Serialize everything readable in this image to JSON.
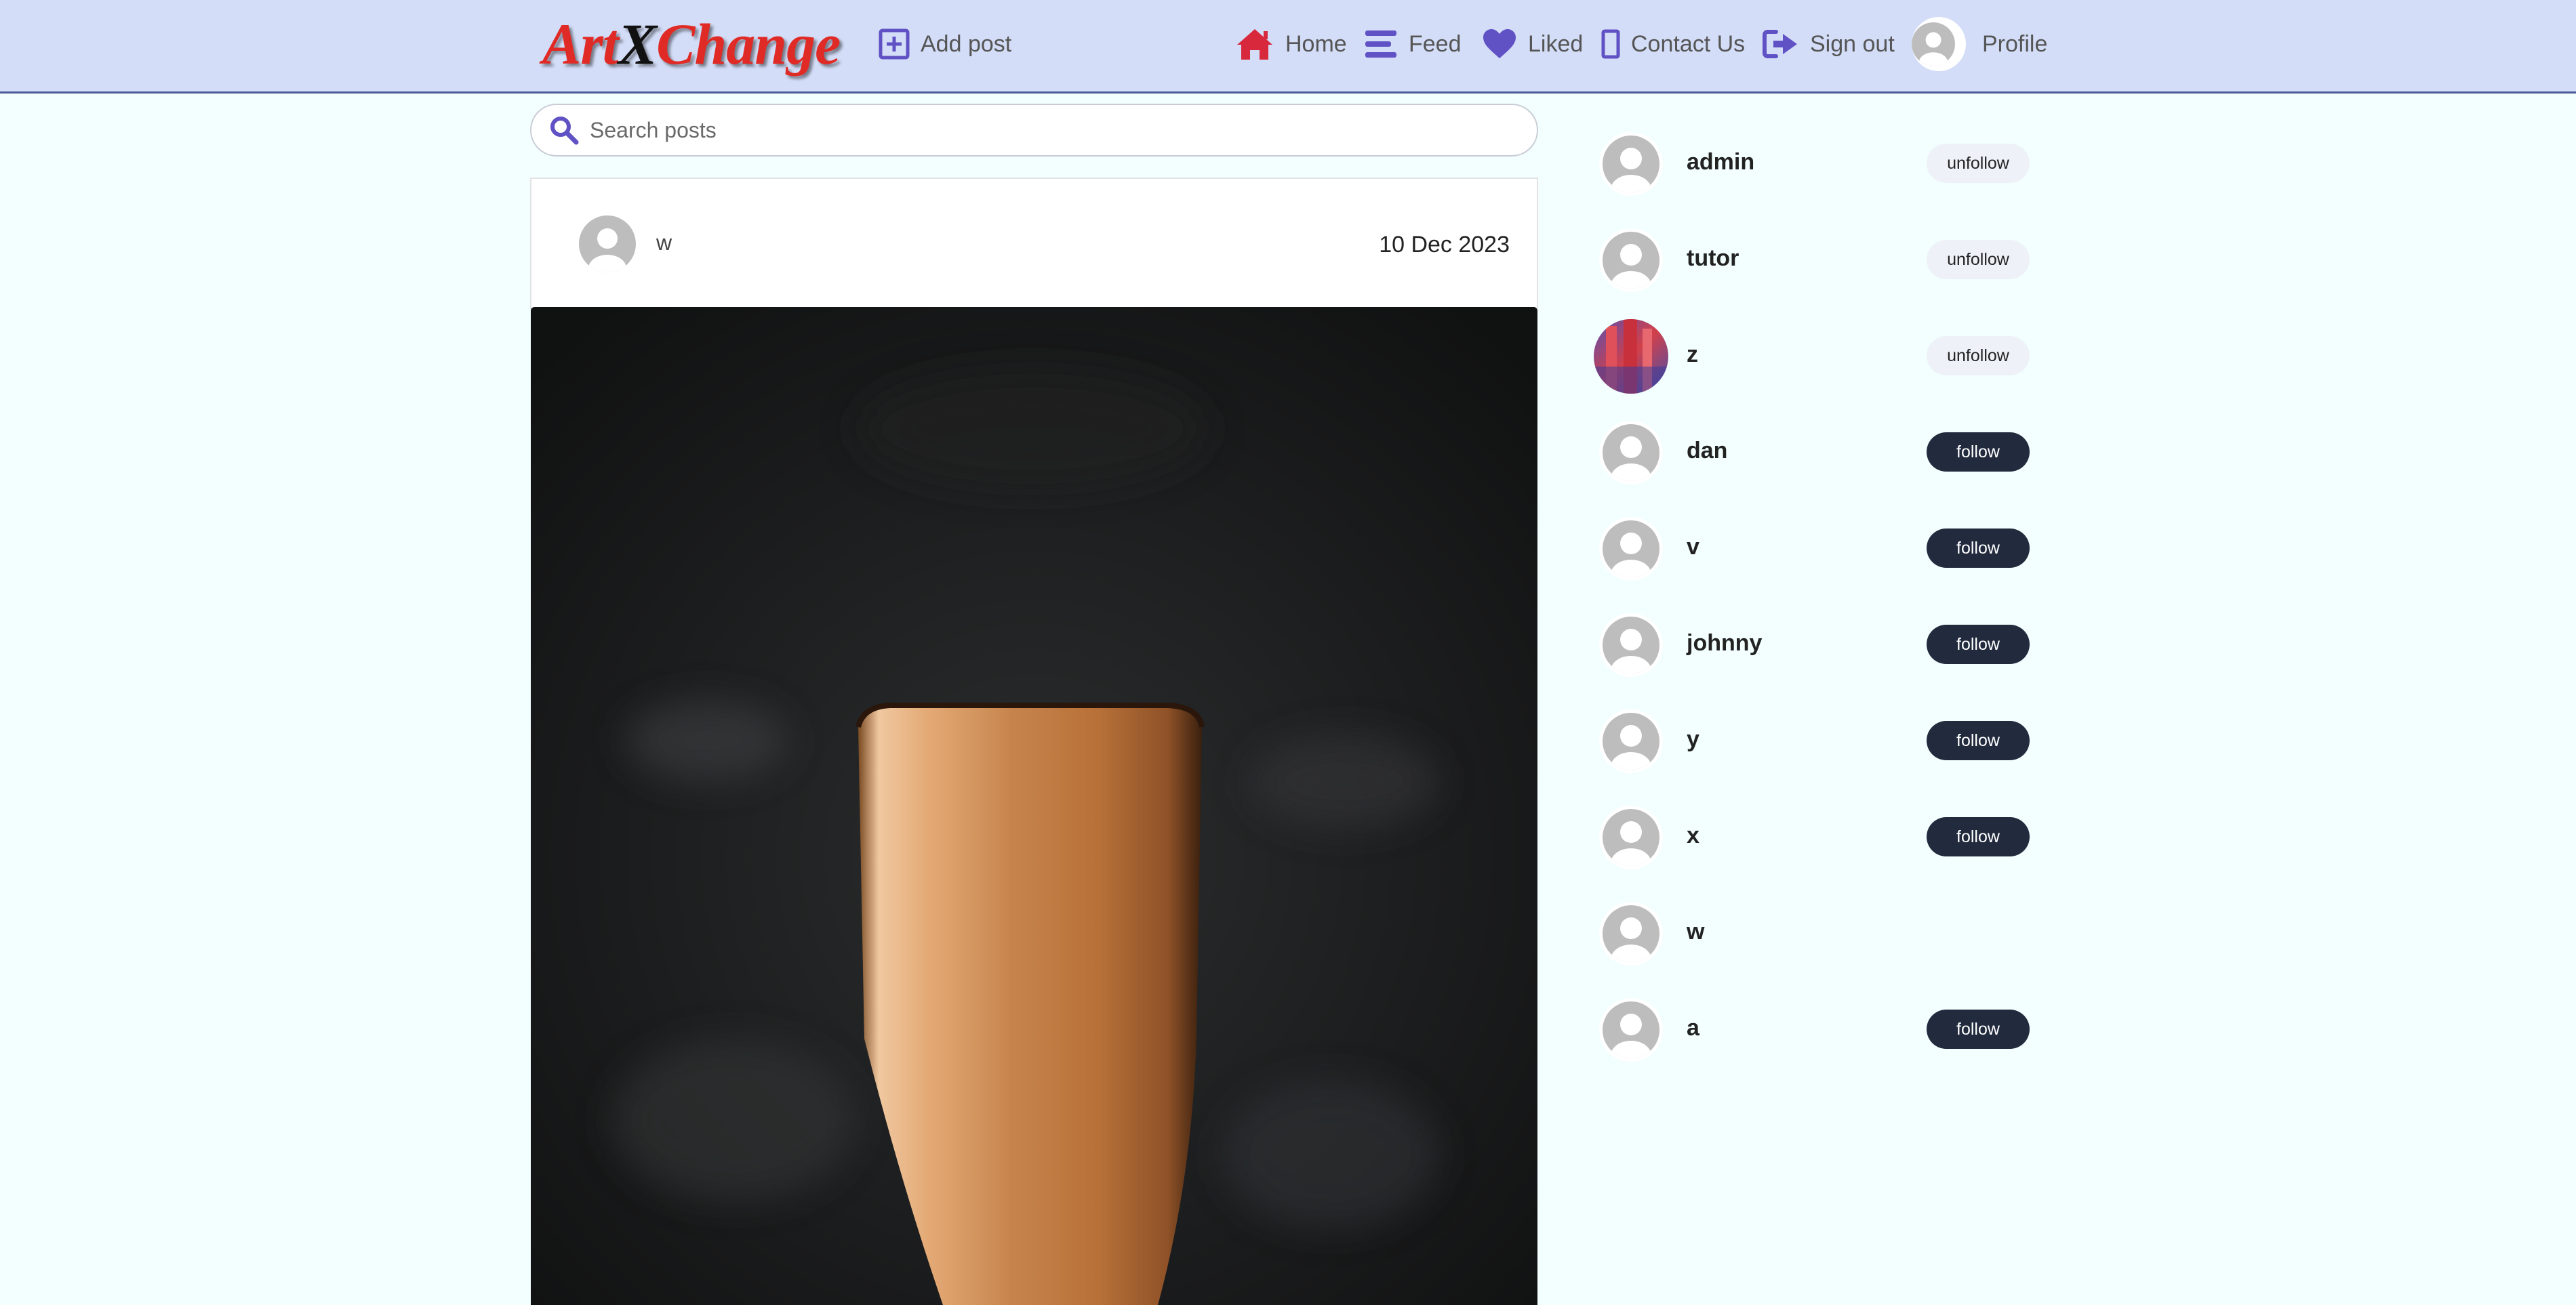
{
  "nav": {
    "logo": {
      "part1": "Art",
      "part2": "X",
      "part3": "Change"
    },
    "add_post": "Add post",
    "home": "Home",
    "feed": "Feed",
    "liked": "Liked",
    "contact": "Contact Us",
    "signout": "Sign out",
    "profile": "Profile"
  },
  "colors": {
    "nav_bg": "#d3ddf7",
    "page_bg": "#f2fffe",
    "accent_purple": "#6052c4",
    "home_red": "#d8283c",
    "follow_btn": "#222a3e",
    "unfollow_btn": "#eef2f8"
  },
  "search": {
    "placeholder": "Search posts",
    "icon": "search-icon"
  },
  "post": {
    "author": "w",
    "date": "10 Dec 2023",
    "image": "photo of a wooden cup on a dark background"
  },
  "users": [
    {
      "name": "admin",
      "action": "unfollow",
      "avatar": "default-avatar"
    },
    {
      "name": "tutor",
      "action": "unfollow",
      "avatar": "default-avatar"
    },
    {
      "name": "z",
      "action": "unfollow",
      "avatar": "photo-avatar"
    },
    {
      "name": "dan",
      "action": "follow",
      "avatar": "default-avatar"
    },
    {
      "name": "v",
      "action": "follow",
      "avatar": "default-avatar"
    },
    {
      "name": "johnny",
      "action": "follow",
      "avatar": "default-avatar"
    },
    {
      "name": "y",
      "action": "follow",
      "avatar": "default-avatar"
    },
    {
      "name": "x",
      "action": "follow",
      "avatar": "default-avatar"
    },
    {
      "name": "w",
      "action": "",
      "avatar": "default-avatar"
    },
    {
      "name": "a",
      "action": "follow",
      "avatar": "default-avatar"
    }
  ]
}
